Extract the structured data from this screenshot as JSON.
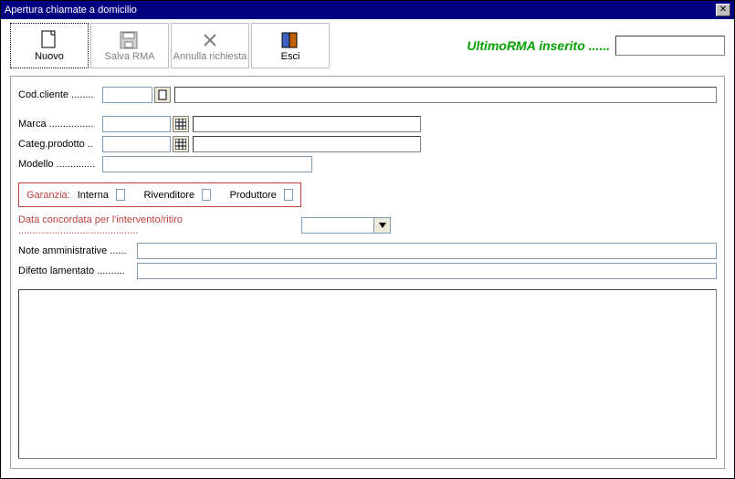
{
  "window": {
    "title": "Apertura chiamate a domicilio"
  },
  "toolbar": {
    "nuovo": "Nuovo",
    "salva_rma": "Salva RMA",
    "annulla": "Annulla richiesta",
    "esci": "Esci"
  },
  "rma_info": {
    "label": "UltimoRMA inserito ......",
    "value": ""
  },
  "fields": {
    "cod_cliente_label": "Cod.cliente ........",
    "cod_cliente_value": "",
    "cod_cliente_desc": "",
    "marca_label": "Marca ................",
    "marca_value": "",
    "marca_desc": "",
    "categ_label": "Categ.prodotto ..",
    "categ_value": "",
    "categ_desc": "",
    "modello_label": "Modello ..............",
    "modello_value": ""
  },
  "garanzia": {
    "title": "Garanzia:",
    "interna": "Interna",
    "rivenditore": "Rivenditore",
    "produttore": "Produttore"
  },
  "date_row": {
    "label": "Data concordata per l'intervento/ritiro ...........................................",
    "value": ""
  },
  "note": {
    "amm_label": "Note amministrative ......",
    "amm_value": "",
    "difetto_label": "Difetto lamentato ..........",
    "difetto_value": ""
  },
  "textarea": ""
}
